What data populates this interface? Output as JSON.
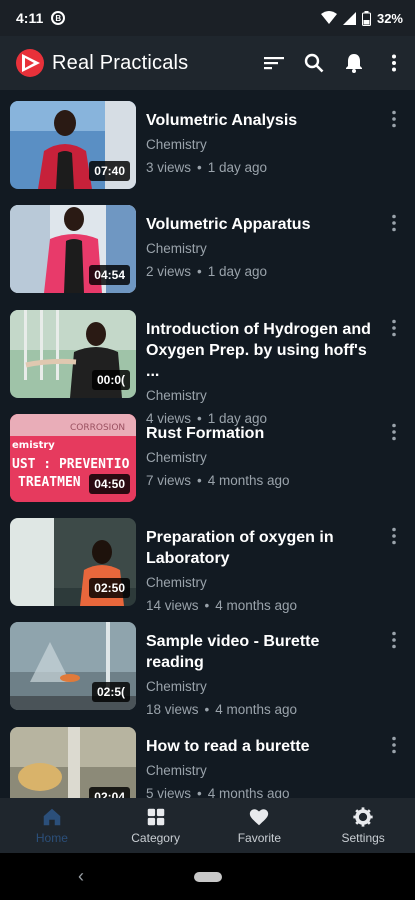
{
  "status": {
    "time": "4:11",
    "battery": "32%"
  },
  "app": {
    "title": "Real Practicals"
  },
  "videos": [
    {
      "title": "Volumetric Analysis",
      "category": "Chemistry",
      "views": "3 views",
      "ago": "1 day ago",
      "duration": "07:40"
    },
    {
      "title": "Volumetric Apparatus",
      "category": "Chemistry",
      "views": "2 views",
      "ago": "1 day ago",
      "duration": "04:54"
    },
    {
      "title": "Introduction of Hydrogen and Oxygen Prep. by using hoff's ...",
      "category": "Chemistry",
      "views": "4 views",
      "ago": "1 day ago",
      "duration": "00:0("
    },
    {
      "title": "Rust Formation",
      "category": "Chemistry",
      "views": "7 views",
      "ago": "4 months ago",
      "duration": "04:50",
      "thumb_text_1": "CORROSION",
      "thumb_text_2": "emistry",
      "thumb_text_3": "UST : PREVENTIO",
      "thumb_text_4": "TREATMEN"
    },
    {
      "title": "Preparation of oxygen in Laboratory",
      "category": "Chemistry",
      "views": "14 views",
      "ago": "4 months ago",
      "duration": "02:50"
    },
    {
      "title": "Sample video - Burette reading",
      "category": "Chemistry",
      "views": "18 views",
      "ago": "4 months ago",
      "duration": "02:5("
    },
    {
      "title": "How to read a burette",
      "category": "Chemistry",
      "views": "5 views",
      "ago": "4 months ago",
      "duration": "02:04"
    }
  ],
  "nav": {
    "home": "Home",
    "category": "Category",
    "favorite": "Favorite",
    "settings": "Settings"
  },
  "colors": {
    "background": "#121a22",
    "appbar": "#1f262d",
    "accent": "#2b4f7a",
    "logo_red": "#e8313a"
  }
}
